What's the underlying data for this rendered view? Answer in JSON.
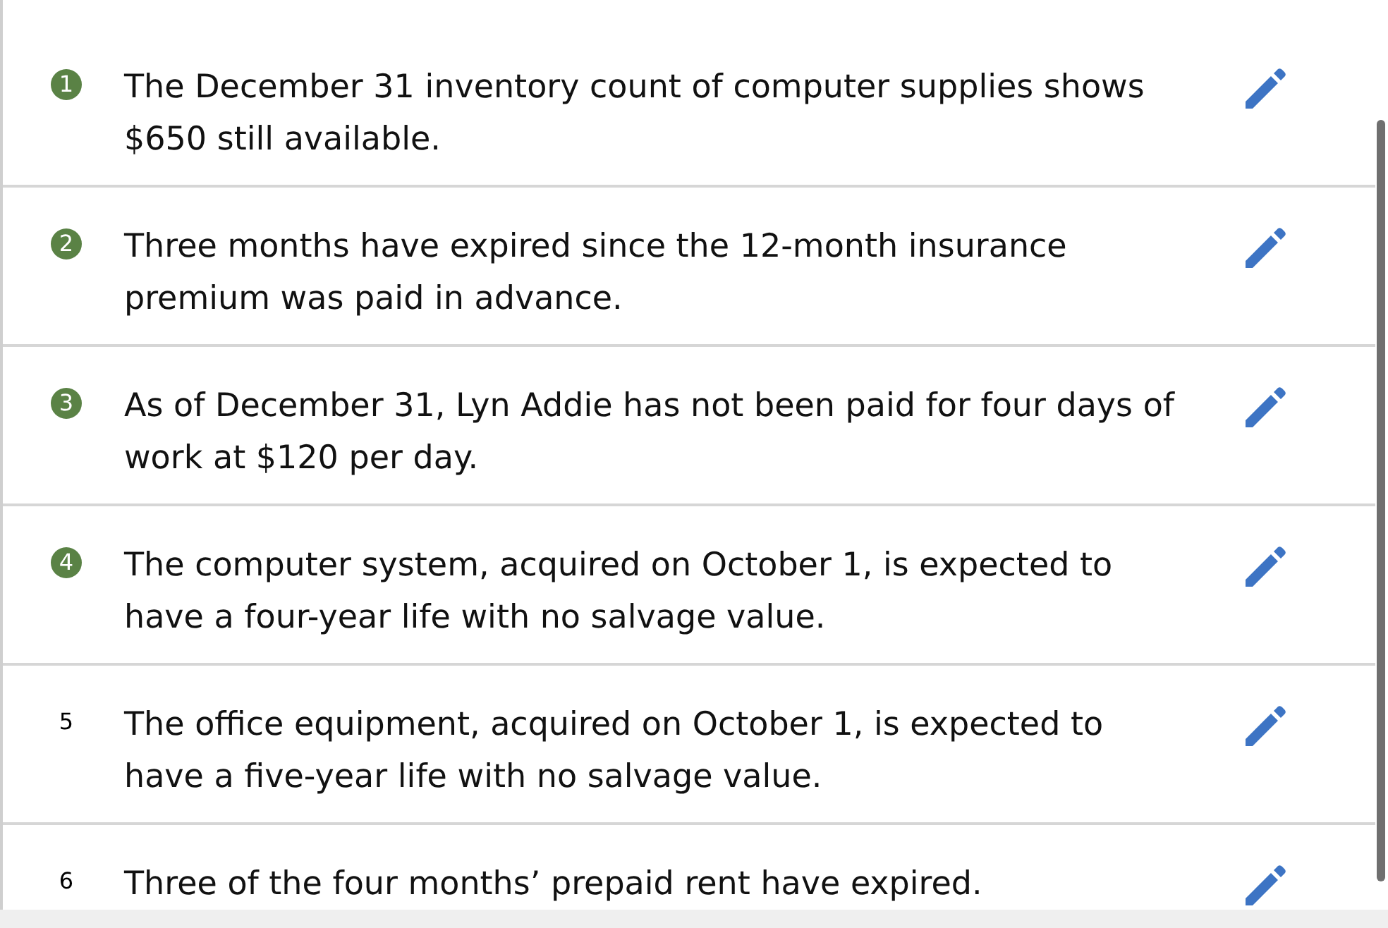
{
  "items": [
    {
      "number": "1",
      "done": true,
      "text": "The December 31 inventory count of computer supplies shows $650 still available."
    },
    {
      "number": "2",
      "done": true,
      "text": "Three months have expired since the 12-month insurance premium was paid in advance."
    },
    {
      "number": "3",
      "done": true,
      "text": "As of December 31, Lyn Addie has not been paid for four days of work at $120 per day."
    },
    {
      "number": "4",
      "done": true,
      "text": "The computer system, acquired on October 1, is expected to have a four-year life with no salvage value."
    },
    {
      "number": "5",
      "done": false,
      "text": "The office equipment, acquired on October 1, is expected to have a five-year life with no salvage value."
    },
    {
      "number": "6",
      "done": false,
      "text": "Three of the four months’ prepaid rent have expired."
    }
  ]
}
